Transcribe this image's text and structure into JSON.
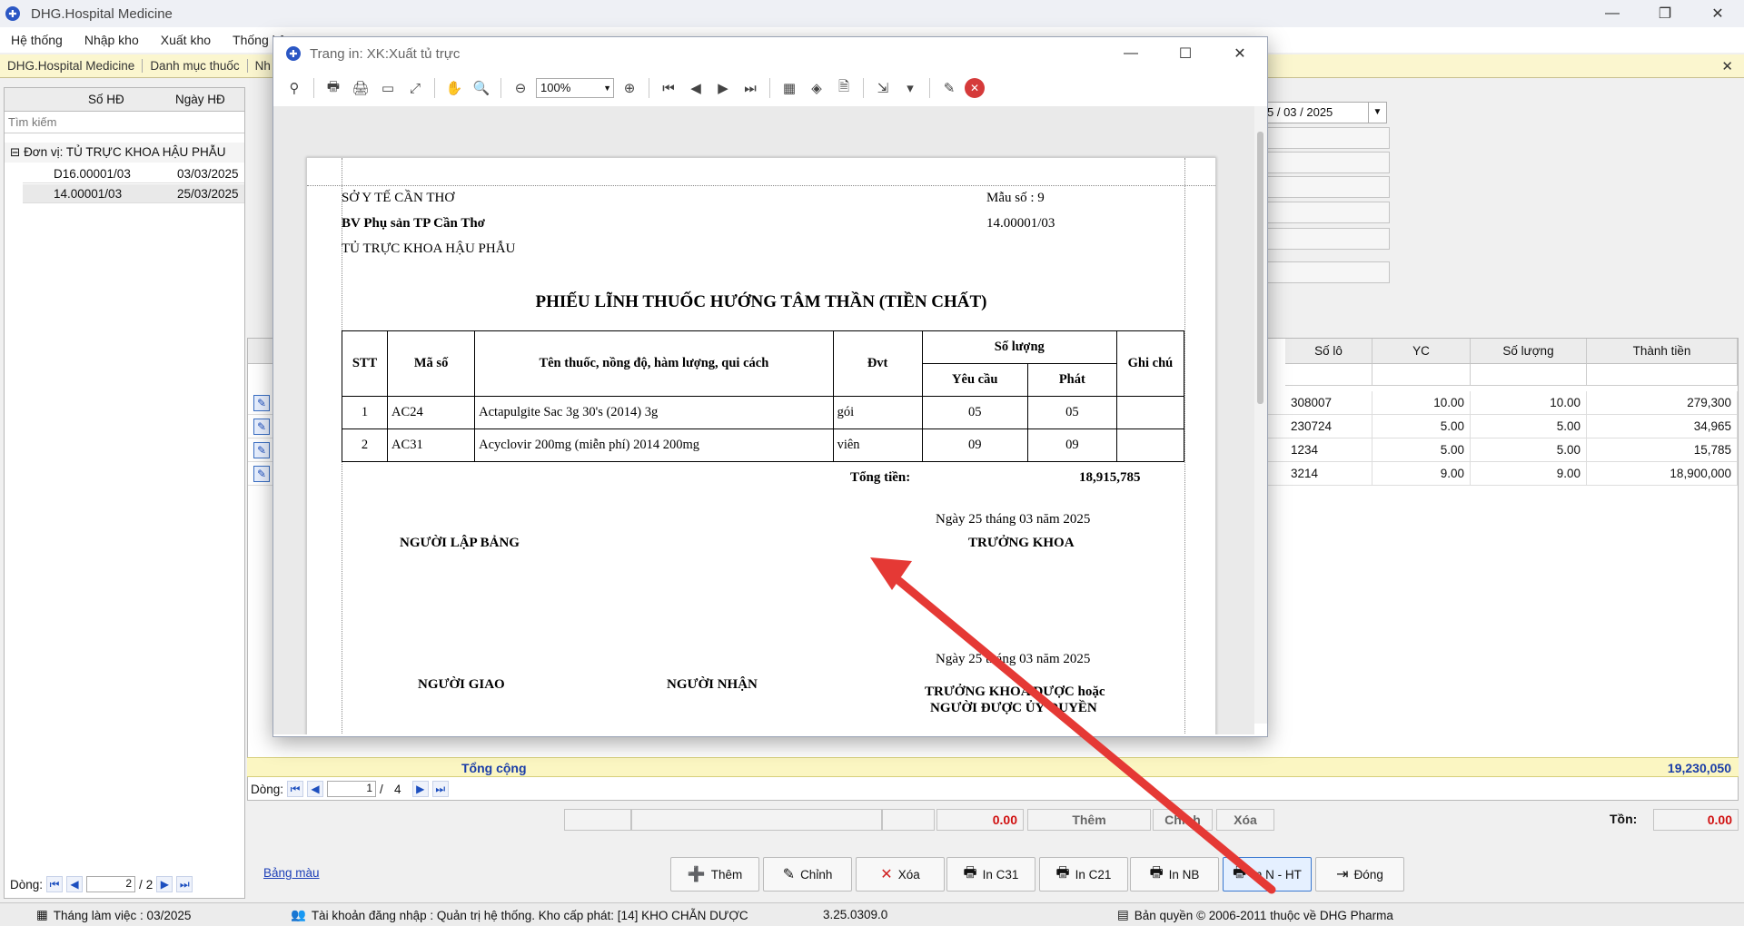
{
  "app": {
    "title": "DHG.Hospital Medicine",
    "icon": "app-icon"
  },
  "menu": [
    "Hệ thống",
    "Nhập kho",
    "Xuất kho",
    "Thống kê"
  ],
  "doc_tabs": [
    "DHG.Hospital Medicine",
    "Danh mục thuốc",
    "Nh"
  ],
  "left": {
    "col_so_hd": "Số HĐ",
    "col_ngay_hd": "Ngày HĐ",
    "search_placeholder": "Tìm kiếm",
    "group_label": "Đơn vị:  TỦ TRỰC KHOA HẬU PHẪU",
    "rows": [
      {
        "so_hd": "D16.00001/03",
        "ngay_hd": "03/03/2025"
      },
      {
        "so_hd": "14.00001/03",
        "ngay_hd": "25/03/2025"
      }
    ],
    "footer_label": "Dòng:",
    "page_current": "2",
    "page_total": "2"
  },
  "right": {
    "date_value": "5 / 03 / 2025",
    "grid_headers": [
      "Số lô",
      "YC",
      "Số lượng",
      "Thành tiền"
    ],
    "grid_rows": [
      {
        "so_lo": "308007",
        "yc": "10.00",
        "so_luong": "10.00",
        "thanh_tien": "279,300"
      },
      {
        "so_lo": "230724",
        "yc": "5.00",
        "so_luong": "5.00",
        "thanh_tien": "34,965"
      },
      {
        "so_lo": "1234",
        "yc": "5.00",
        "so_luong": "5.00",
        "thanh_tien": "15,785"
      },
      {
        "so_lo": "3214",
        "yc": "9.00",
        "so_luong": "9.00",
        "thanh_tien": "18,900,000"
      }
    ],
    "total_label": "Tổng cộng",
    "total_value": "19,230,050",
    "dong_label": "Dòng:",
    "dong_current": "1",
    "dong_total": "4",
    "sum_value": "0.00",
    "them_label": "Thêm",
    "chinh_label": "Chỉnh",
    "xoa_label": "Xóa",
    "ton_label": "Tồn:",
    "ton_value": "0.00"
  },
  "toolbar": {
    "bang_mau": "Bảng màu",
    "buttons": [
      "Thêm",
      "Chỉnh",
      "Xóa",
      "In C31",
      "In C21",
      "In NB",
      "In N - HT",
      "Đóng"
    ]
  },
  "status": {
    "month": "Tháng làm việc : 03/2025",
    "account": "Tài khoản đăng nhập : Quản trị hệ thống. Kho cấp phát: [14] KHO CHẴN DƯỢC",
    "version": "3.25.0309.0",
    "copyright": "Bản quyền © 2006-2011 thuộc về DHG Pharma"
  },
  "dialog": {
    "title": "Trang in: XK:Xuất tủ trực",
    "zoom": "100%"
  },
  "paper": {
    "org1": "SỞ Y TẾ CẦN THƠ",
    "org2": "BV Phụ sản TP Cần Thơ",
    "org3": "TỦ TRỰC KHOA HẬU PHẪU",
    "form_no": "Mẫu số : 9",
    "doc_no": "14.00001/03",
    "title": "PHIẾU LĨNH THUỐC HƯỚNG TÂM THẦN (TIỀN CHẤT)",
    "th_stt": "STT",
    "th_ma_so": "Mã số",
    "th_ten": "Tên thuốc, nồng độ, hàm lượng, qui cách",
    "th_dvt": "Đvt",
    "th_so_luong": "Số lượng",
    "th_yeu_cau": "Yêu cầu",
    "th_phat": "Phát",
    "th_ghi_chu": "Ghi chú",
    "rows": [
      {
        "stt": "1",
        "ma": "AC24",
        "ten": "Actapulgite Sac 3g 30's (2014) 3g",
        "dvt": "gói",
        "yc": "05",
        "phat": "05"
      },
      {
        "stt": "2",
        "ma": "AC31",
        "ten": "Acyclovir 200mg (miễn phí) 2014 200mg",
        "dvt": "viên",
        "yc": "09",
        "phat": "09"
      }
    ],
    "tong_tien_label": "Tổng tiền:",
    "tong_tien_value": "18,915,785",
    "date1": "Ngày 25 tháng 03 năm 2025",
    "nguoi_lap": "NGƯỜI LẬP BẢNG",
    "truong_khoa": "TRƯỞNG KHOA",
    "date2": "Ngày 25 tháng 03 năm 2025",
    "nguoi_giao": "NGƯỜI GIAO",
    "nguoi_nhan": "NGƯỜI NHẬN",
    "truong_khoa_duoc": "TRƯỞNG KHOA DƯỢC hoặc",
    "nguoi_uy_quyen": "NGƯỜI ĐƯỢC ỦY QUYỀN"
  },
  "annotation": {
    "arrow_color": "#e53935"
  }
}
